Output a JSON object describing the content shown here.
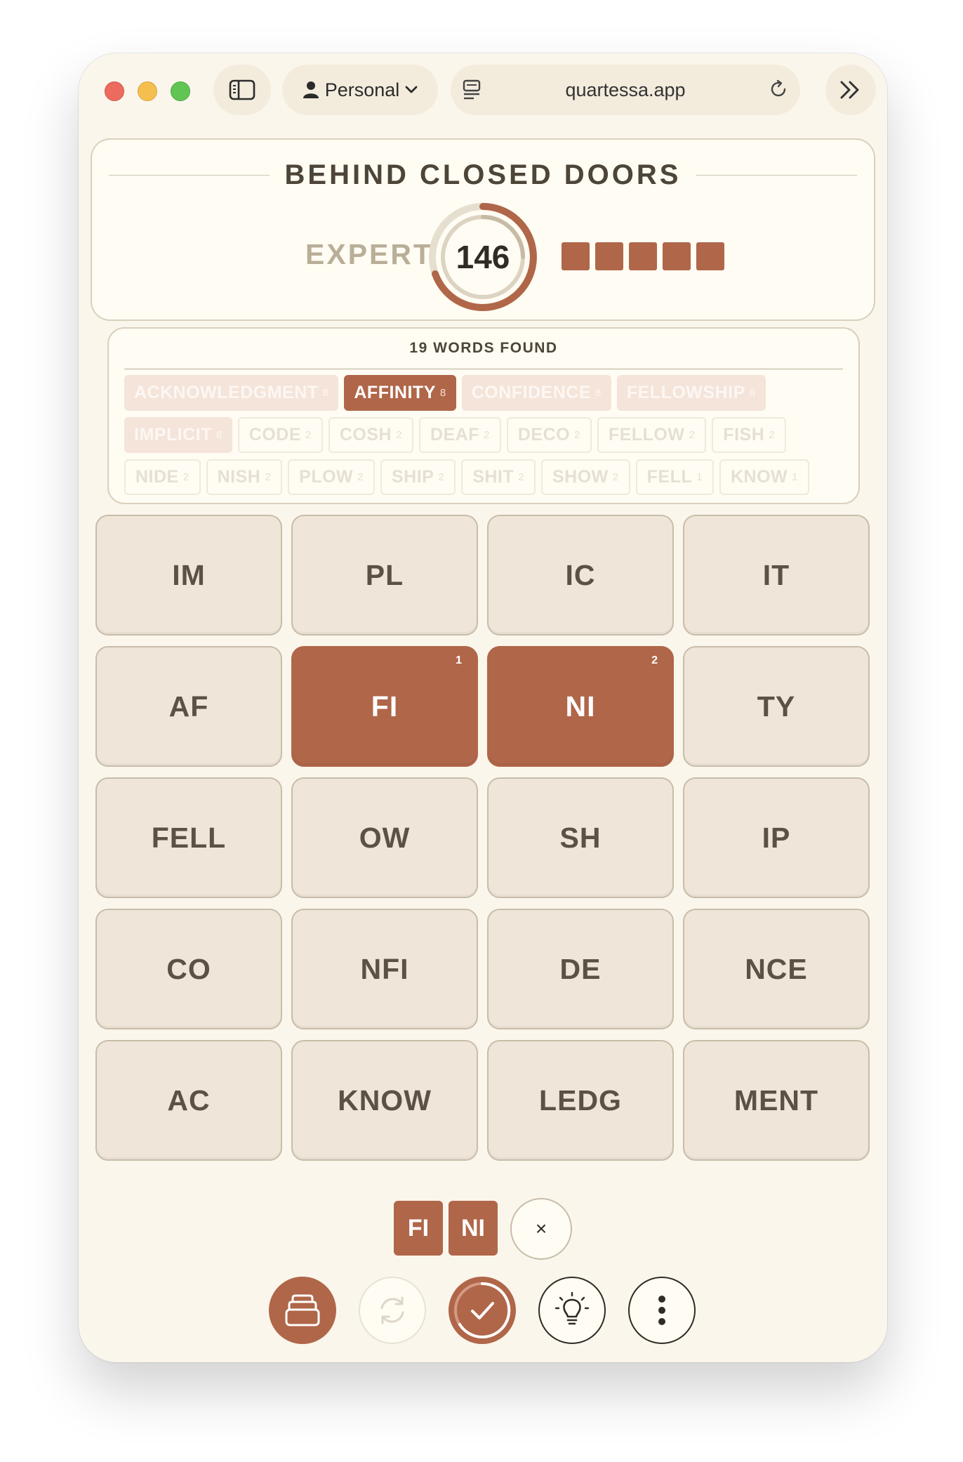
{
  "browser": {
    "profile_label": "Personal",
    "url": "quartessa.app"
  },
  "puzzle": {
    "title": "BEHIND CLOSED DOORS",
    "level": "EXPERT",
    "score": "146",
    "lives_remaining": 5
  },
  "words_found": {
    "heading": "19 WORDS FOUND",
    "rows": [
      [
        {
          "word": "ACKNOWLEDGMENT",
          "count": "8",
          "style": "pale"
        },
        {
          "word": "AFFINITY",
          "count": "8",
          "style": "active"
        },
        {
          "word": "CONFIDENCE",
          "count": "8",
          "style": "pale"
        },
        {
          "word": "FELLOWSHIP",
          "count": "8",
          "style": "pale"
        }
      ],
      [
        {
          "word": "IMPLICIT",
          "count": "8",
          "style": "pale"
        },
        {
          "word": "CODE",
          "count": "2",
          "style": "ghost"
        },
        {
          "word": "COSH",
          "count": "2",
          "style": "ghost"
        },
        {
          "word": "DEAF",
          "count": "2",
          "style": "ghost"
        },
        {
          "word": "DECO",
          "count": "2",
          "style": "ghost"
        },
        {
          "word": "FELLOW",
          "count": "2",
          "style": "ghost"
        },
        {
          "word": "FISH",
          "count": "2",
          "style": "ghost"
        }
      ],
      [
        {
          "word": "NIDE",
          "count": "2",
          "style": "ghost"
        },
        {
          "word": "NISH",
          "count": "2",
          "style": "ghost"
        },
        {
          "word": "PLOW",
          "count": "2",
          "style": "ghost"
        },
        {
          "word": "SHIP",
          "count": "2",
          "style": "ghost"
        },
        {
          "word": "SHIT",
          "count": "2",
          "style": "ghost"
        },
        {
          "word": "SHOW",
          "count": "2",
          "style": "ghost"
        },
        {
          "word": "FELL",
          "count": "1",
          "style": "ghost"
        },
        {
          "word": "KNOW",
          "count": "1",
          "style": "ghost"
        }
      ]
    ]
  },
  "board": {
    "tiles": [
      {
        "text": "IM"
      },
      {
        "text": "PL"
      },
      {
        "text": "IC"
      },
      {
        "text": "IT"
      },
      {
        "text": "AF"
      },
      {
        "text": "FI",
        "selected": true,
        "order": "1"
      },
      {
        "text": "NI",
        "selected": true,
        "order": "2"
      },
      {
        "text": "TY"
      },
      {
        "text": "FELL"
      },
      {
        "text": "OW"
      },
      {
        "text": "SH"
      },
      {
        "text": "IP"
      },
      {
        "text": "CO"
      },
      {
        "text": "NFI"
      },
      {
        "text": "DE"
      },
      {
        "text": "NCE"
      },
      {
        "text": "AC"
      },
      {
        "text": "KNOW"
      },
      {
        "text": "LEDG"
      },
      {
        "text": "MENT"
      }
    ]
  },
  "selection": {
    "pieces": [
      "FI",
      "NI"
    ],
    "clear_label": "×"
  },
  "toolbar": {
    "icons": [
      "stack-icon",
      "shuffle-icon",
      "submit-check-icon",
      "hint-bulb-icon",
      "more-vertical-icon"
    ]
  },
  "colors": {
    "accent": "#b06649",
    "background": "#faf6ec",
    "tile": "#efe5d8"
  }
}
